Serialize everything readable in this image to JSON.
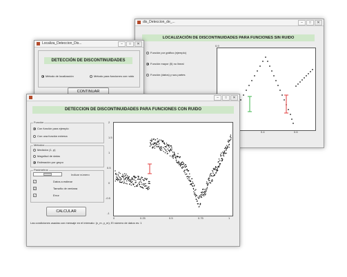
{
  "window_back": {
    "title": "dis_Deteccion_de_...",
    "banner": "LOCALIZACIÓN DE DISCONTINUIDADES PARA FUNCIONES SIN RUIDO",
    "options": [
      "Función por gráfico (ejemplo)",
      "Función mayor (5) no lineal",
      "Función (datos) y sus partes"
    ],
    "x_ticks": [
      "0.4",
      "0.6"
    ],
    "y_ticks": [
      "0.9",
      "0.7",
      "0.6",
      "0.5",
      "0.4",
      "0.3"
    ]
  },
  "window_mid": {
    "title": "Localiza_Deteccion_Dis...",
    "banner": "DETECCIÓN DE DISCONTINUIDADES",
    "radio_left": "Método de localización",
    "radio_right": "Método para funciones con ruido",
    "continue_label": "CONTINUAR"
  },
  "window_front": {
    "title": "",
    "banner": "DETECCION DE DISCONTINUIDADES PARA FUNCIONES CON RUIDO",
    "group1": {
      "title": "Función",
      "options": [
        "Con función para ejemplo",
        "Con una función externa"
      ]
    },
    "group2": {
      "title": "Métodos",
      "options": [
        "Medición (1, p)",
        "Magnitud de datos",
        "Estimación por grupo"
      ]
    },
    "group3": {
      "title": "Parámetros",
      "stepper_label": "Indicar número",
      "rows": [
        {
          "box": "✓",
          "label": "Datos a estimar"
        },
        {
          "box": "2",
          "label": "Tamaño de ventana"
        },
        {
          "box": "✓",
          "label": "Error"
        }
      ]
    },
    "calc_label": "CALCULAR",
    "status": "Las condiciones usadas con mensaje en el intervalo: (x_m, y_m); El número de datos es: 1",
    "x_ticks": [
      "0",
      "0.25",
      "0.5",
      "0.75",
      "1"
    ],
    "y_ticks": [
      "2",
      "1.5",
      "1",
      "0.5",
      "0",
      "-0.5",
      "-1"
    ]
  },
  "colors": {
    "banner_green": "#cfe7c9",
    "marker_red": "#e23a3a",
    "marker_green": "#3cb44b"
  }
}
